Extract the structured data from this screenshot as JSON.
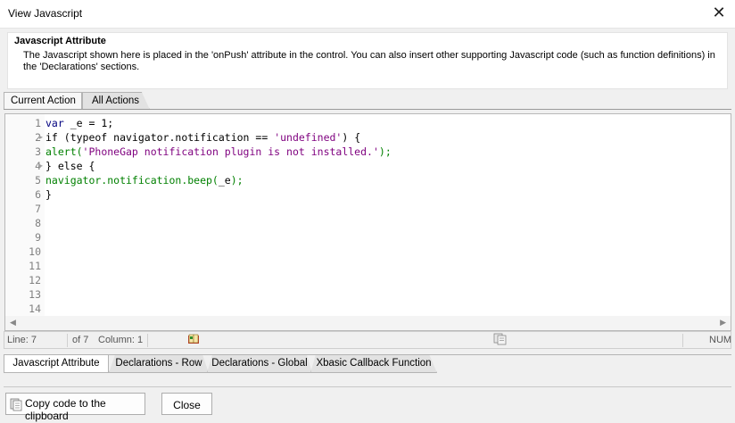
{
  "window": {
    "title": "View Javascript"
  },
  "info": {
    "heading": "Javascript Attribute",
    "description": "The Javascript shown here is placed in the 'onPush' attribute in the control. You can also insert other supporting Javascript code (such as function definitions) in the 'Declarations' sections."
  },
  "top_tabs": [
    "Current Action",
    "All Actions"
  ],
  "editor": {
    "line_numbers": [
      "1",
      "2",
      "3",
      "4",
      "5",
      "6",
      "7",
      "8",
      "9",
      "10",
      "11",
      "12",
      "13",
      "14"
    ],
    "lines": [
      [
        {
          "t": "var",
          "c": "#00007f"
        },
        {
          "t": " _e = 1;",
          "c": "#000000"
        }
      ],
      [
        {
          "t": "if (typeof navigator.notification == ",
          "c": "#000000"
        },
        {
          "t": "'undefined'",
          "c": "#7f007f"
        },
        {
          "t": ") {",
          "c": "#000000"
        }
      ],
      [
        {
          "t": "alert(",
          "c": "#008000"
        },
        {
          "t": "'PhoneGap notification plugin is not installed.'",
          "c": "#7f007f"
        },
        {
          "t": ");",
          "c": "#008000"
        }
      ],
      [
        {
          "t": "} else {",
          "c": "#000000"
        }
      ],
      [
        {
          "t": "navigator.notification.beep(",
          "c": "#008000"
        },
        {
          "t": "_e",
          "c": "#000000"
        },
        {
          "t": ");",
          "c": "#008000"
        }
      ],
      [
        {
          "t": "}",
          "c": "#000000"
        }
      ]
    ]
  },
  "status": {
    "line": "Line: 7",
    "of": "of 7",
    "column": "Column: 1",
    "num": "NUM"
  },
  "bottom_tabs": [
    "Javascript  Attribute",
    "Declarations - Row",
    "Declarations - Global",
    "Xbasic Callback Function"
  ],
  "buttons": {
    "copy": "Copy code to the clipboard",
    "close": "Close"
  },
  "icons": {
    "close": "close-icon",
    "copy": "clipboard-icon",
    "book": "book-icon",
    "pages": "pages-icon"
  }
}
